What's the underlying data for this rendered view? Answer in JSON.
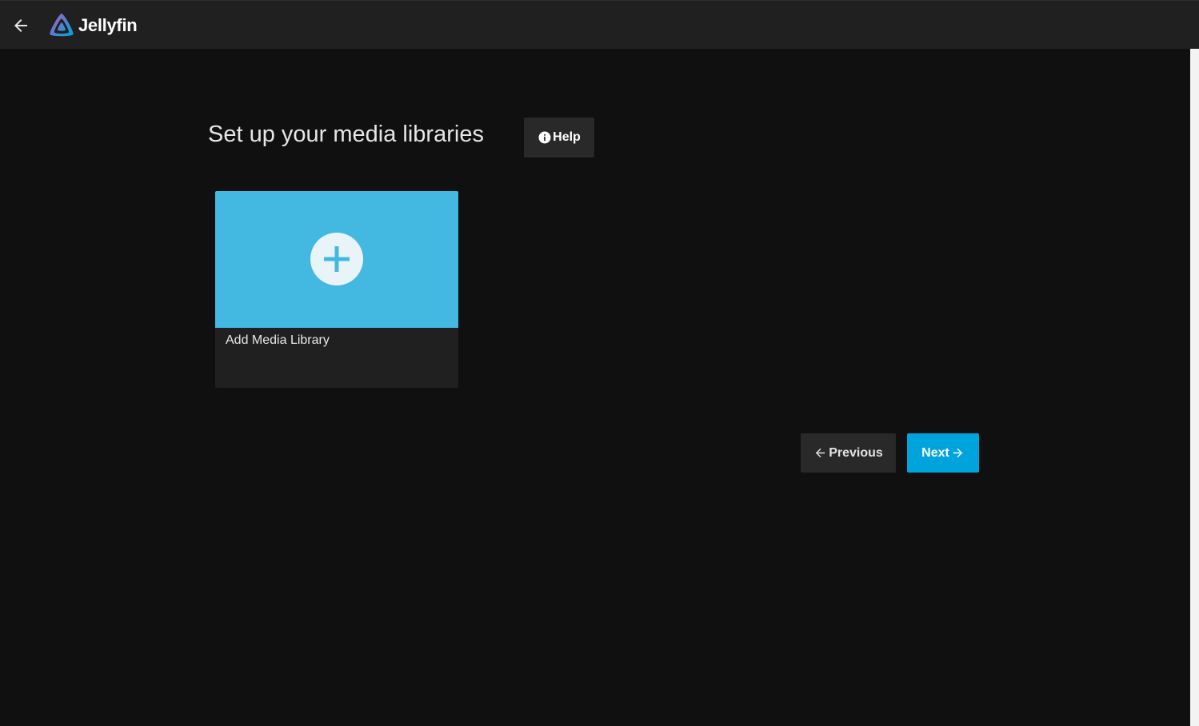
{
  "header": {
    "app_name": "Jellyfin",
    "icons": {
      "back": "arrow-left-icon",
      "logo": "jellyfin-logo-icon"
    }
  },
  "wizard": {
    "title": "Set up your media libraries",
    "help_label": "Help",
    "help_icon": "info-icon"
  },
  "libraries": {
    "add_card_label": "Add Media Library",
    "add_icon": "plus-icon"
  },
  "navigation": {
    "previous_label": "Previous",
    "next_label": "Next"
  },
  "colors": {
    "accent": "#00a4dc",
    "card_image": "#43b9e1",
    "background": "#101010",
    "header": "#202020"
  }
}
